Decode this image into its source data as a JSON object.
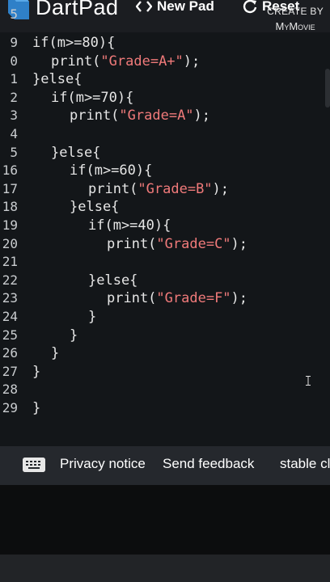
{
  "header": {
    "app_title": "DartPad",
    "new_pad_label": "New Pad",
    "reset_label": "Reset",
    "watermark_line1": "CREATE BY",
    "watermark_line2": "MyMovie"
  },
  "editor": {
    "lines": [
      {
        "num": "5",
        "code": ""
      },
      {
        "num": "9",
        "indent": 0,
        "pre": "if(m>=80){",
        "str": "",
        "post": ""
      },
      {
        "num": "0",
        "indent": 1,
        "pre": "print(",
        "str": "\"Grade=A+\"",
        "post": ");"
      },
      {
        "num": "1",
        "indent": 0,
        "pre": "}else{",
        "str": "",
        "post": ""
      },
      {
        "num": "2",
        "indent": 1,
        "pre": "if(m>=70){",
        "str": "",
        "post": ""
      },
      {
        "num": "3",
        "indent": 2,
        "pre": "print(",
        "str": "\"Grade=A\"",
        "post": ");"
      },
      {
        "num": "4",
        "indent": 0,
        "pre": "",
        "str": "",
        "post": ""
      },
      {
        "num": "5",
        "indent": 1,
        "pre": "}else{",
        "str": "",
        "post": ""
      },
      {
        "num": "16",
        "indent": 2,
        "pre": "if(m>=60){",
        "str": "",
        "post": ""
      },
      {
        "num": "17",
        "indent": 3,
        "pre": "print(",
        "str": "\"Grade=B\"",
        "post": ");"
      },
      {
        "num": "18",
        "indent": 2,
        "pre": "}else{",
        "str": "",
        "post": ""
      },
      {
        "num": "19",
        "indent": 3,
        "pre": "if(m>=40){",
        "str": "",
        "post": ""
      },
      {
        "num": "20",
        "indent": 4,
        "pre": "print(",
        "str": "\"Grade=C\"",
        "post": ");"
      },
      {
        "num": "21",
        "indent": 0,
        "pre": "",
        "str": "",
        "post": ""
      },
      {
        "num": "22",
        "indent": 3,
        "pre": "}else{",
        "str": "",
        "post": ""
      },
      {
        "num": "23",
        "indent": 4,
        "pre": "print(",
        "str": "\"Grade=F\"",
        "post": ");"
      },
      {
        "num": "24",
        "indent": 3,
        "pre": "}",
        "str": "",
        "post": ""
      },
      {
        "num": "25",
        "indent": 2,
        "pre": "}",
        "str": "",
        "post": ""
      },
      {
        "num": "26",
        "indent": 1,
        "pre": "}",
        "str": "",
        "post": ""
      },
      {
        "num": "27",
        "indent": 0,
        "pre": "}",
        "str": "",
        "post": ""
      },
      {
        "num": "28",
        "indent": 0,
        "pre": "",
        "str": "",
        "post": ""
      },
      {
        "num": "29",
        "indent": 0,
        "pre": "}",
        "str": "",
        "post": ""
      }
    ]
  },
  "footer": {
    "privacy_label": "Privacy notice",
    "feedback_label": "Send feedback",
    "channel_label": "stable cl"
  },
  "colors": {
    "string": "#f07a7a",
    "code_text": "#e6e6e6",
    "line_number": "#c9cccf",
    "editor_bg": "#131619",
    "header_bg": "#1b1d21",
    "footer_bg": "#25282d"
  }
}
